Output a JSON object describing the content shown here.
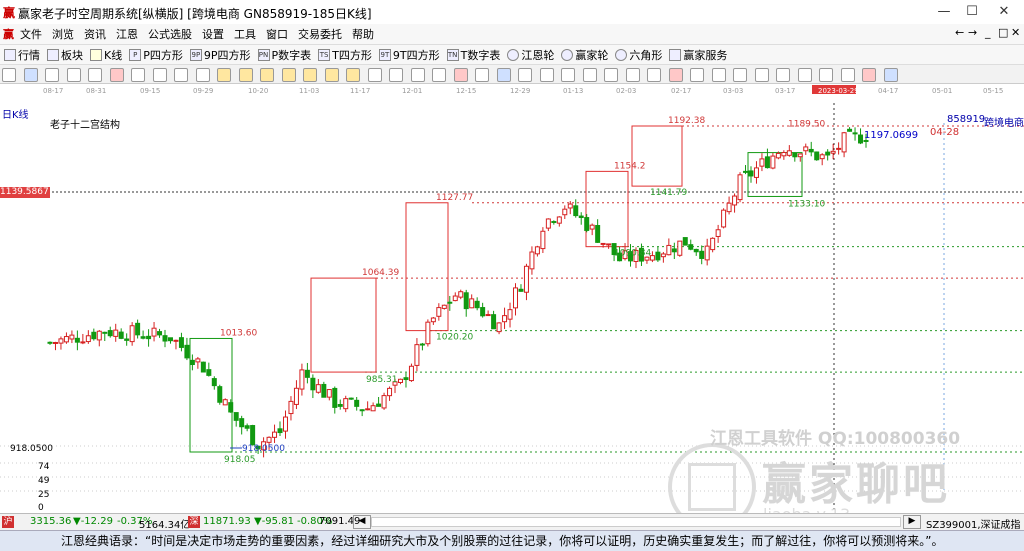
{
  "window": {
    "title": "赢家老子时空周期系统[纵横版]  [跨境电商  GN858919-185日K线]",
    "app_icon": "app-logo-icon",
    "minimize": "—",
    "maximize": "☐",
    "close": "✕"
  },
  "menu": {
    "items": [
      "文件",
      "浏览",
      "资讯",
      "江恩",
      "公式选股",
      "设置",
      "工具",
      "窗口",
      "交易委托",
      "帮助"
    ],
    "right_controls": [
      "←",
      "→",
      "_",
      "□",
      "✕"
    ]
  },
  "toolbar": {
    "items": [
      {
        "label": "行情",
        "icon": "quote-icon"
      },
      {
        "label": "板块",
        "icon": "sector-icon"
      },
      {
        "label": "K线",
        "icon": "kline-icon"
      },
      {
        "label": "P四方形",
        "icon": "p-square-icon",
        "badge": "P"
      },
      {
        "label": "9P四方形",
        "icon": "9p-square-icon",
        "badge": "9P"
      },
      {
        "label": "P数字表",
        "icon": "p-number-table-icon",
        "badge": "PN"
      },
      {
        "label": "T四方形",
        "icon": "t-square-icon",
        "badge": "TS"
      },
      {
        "label": "9T四方形",
        "icon": "9t-square-icon",
        "badge": "9T"
      },
      {
        "label": "T数字表",
        "icon": "t-number-table-icon",
        "badge": "TN"
      },
      {
        "label": "江恩轮",
        "icon": "gann-wheel-icon"
      },
      {
        "label": "赢家轮",
        "icon": "winner-wheel-icon"
      },
      {
        "label": "六角形",
        "icon": "hexagon-icon"
      },
      {
        "label": "赢家服务",
        "icon": "service-icon"
      }
    ]
  },
  "date_axis": [
    "08-17",
    "08-31",
    "09-15",
    "09-29",
    "10-20",
    "11-03",
    "11-17",
    "12-01",
    "12-15",
    "12-29",
    "01-13",
    "02-03",
    "02-17",
    "03-03",
    "03-17",
    "2023-03-29",
    "04-17",
    "05-01",
    "05-15"
  ],
  "chart": {
    "period_label": "日K线",
    "pattern_label": "老子十二宫结构",
    "stock_code": "858919",
    "stock_name": "跨境电商",
    "left_price_flag": "1139.5867",
    "last_price_label": "1197.0699",
    "date_marker": "04-28",
    "price_annotations": [
      "1192.38",
      "1154.2",
      "1141.79",
      "1133.10",
      "1189.50",
      "1127.77",
      "1090.84",
      "1064.39",
      "1020.20",
      "1013.60",
      "985.31",
      "918.0500",
      "918.05"
    ],
    "axis_labels": [
      "918.0500",
      "74",
      "49",
      "25",
      "0"
    ]
  },
  "chart_data": {
    "type": "candlestick",
    "title": "",
    "ohlc_note": "approximate closes read from chart",
    "x": [
      "08-17",
      "08-31",
      "09-15",
      "09-29",
      "10-20",
      "11-03",
      "11-17",
      "12-01",
      "12-15",
      "12-29",
      "01-13",
      "02-03",
      "02-17",
      "03-03",
      "03-17",
      "03-29",
      "04-17"
    ],
    "close": [
      1010,
      1005,
      1000,
      935,
      960,
      960,
      1005,
      1000,
      1110,
      1080,
      1085,
      1145,
      1175,
      1170,
      1165,
      1185,
      1190
    ],
    "annotations": [
      {
        "label": "918.05",
        "value": 918.05
      },
      {
        "label": "1013.60",
        "value": 1013.6
      },
      {
        "label": "985.31",
        "value": 985.31
      },
      {
        "label": "1064.39",
        "value": 1064.39
      },
      {
        "label": "1020.20",
        "value": 1020.2
      },
      {
        "label": "1127.77",
        "value": 1127.77
      },
      {
        "label": "1090.84",
        "value": 1090.84
      },
      {
        "label": "1154.2",
        "value": 1154.2
      },
      {
        "label": "1141.79",
        "value": 1141.79
      },
      {
        "label": "1192.38",
        "value": 1192.38
      },
      {
        "label": "1133.10",
        "value": 1133.1
      },
      {
        "label": "1189.50",
        "value": 1189.5
      },
      {
        "label": "1197.0699",
        "value": 1197.0699
      }
    ],
    "colors": {
      "up": "#d62020",
      "down": "#119911",
      "box_red": "#e03030",
      "box_green": "#129912"
    }
  },
  "watermark": {
    "line1": "江恩工具软件  QQ:100800360",
    "line2": "赢家聊吧",
    "line3": "liaoba.v.13"
  },
  "status_bar": {
    "sh_index": "3315.36",
    "sh_change": "▼-12.29",
    "sh_pct": "-0.37%",
    "sh_amount": "5164.34亿",
    "sz_index": "11871.93",
    "sz_change": "▼-95.81",
    "sz_pct": "-0.80%",
    "sz_amount": "7091.49",
    "right_label": "SZ399001,深证成指",
    "sh_icon": "沪",
    "sz_icon": "深"
  },
  "footer": {
    "text": "江恩经典语录：“时间是决定市场走势的重要因素，经过详细研究大市及个别股票的过往记录，你将可以证明，历史确实重复发生；而了解过往，你将可以预测将来。”。"
  }
}
